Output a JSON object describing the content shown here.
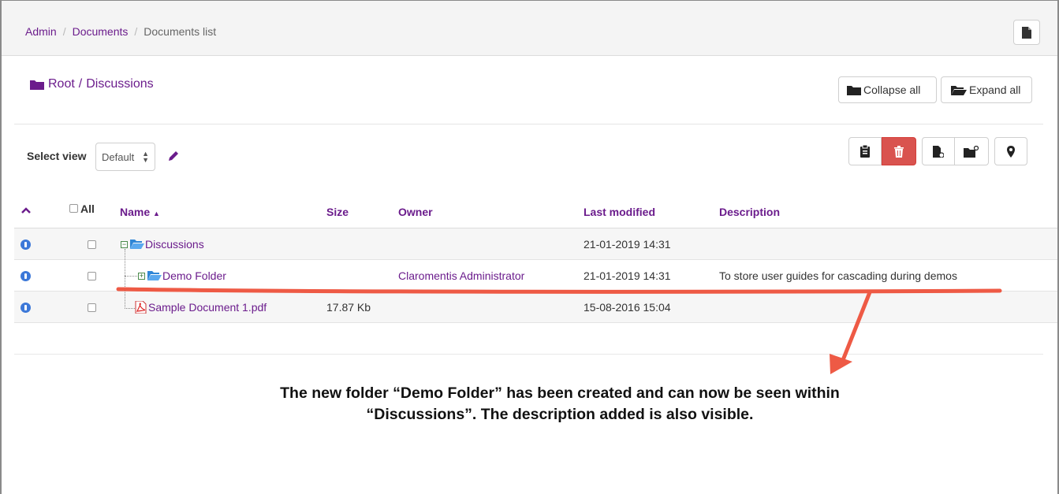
{
  "breadcrumb": {
    "items": [
      "Admin",
      "Documents"
    ],
    "current": "Documents list"
  },
  "path": {
    "root": "Root",
    "separator": "/",
    "folder": "Discussions"
  },
  "buttons": {
    "collapse_all": "Collapse all",
    "expand_all": "Expand all"
  },
  "select_view": {
    "label": "Select view",
    "value": "Default"
  },
  "table": {
    "headers": {
      "all": "All",
      "name": "Name",
      "size": "Size",
      "owner": "Owner",
      "last_modified": "Last modified",
      "description": "Description"
    },
    "rows": [
      {
        "name": "Discussions",
        "size": "",
        "owner": "",
        "last_modified": "21-01-2019 14:31",
        "description": ""
      },
      {
        "name": "Demo Folder",
        "size": "",
        "owner": "Claromentis Administrator",
        "last_modified": "21-01-2019 14:31",
        "description": "To store user guides for cascading during demos"
      },
      {
        "name": "Sample Document 1.pdf",
        "size": "17.87 Kb",
        "owner": "",
        "last_modified": "15-08-2016 15:04",
        "description": ""
      }
    ]
  },
  "annotation": "The new folder “Demo Folder” has been created and can now be seen within “Discussions”. The description added is also visible.",
  "colors": {
    "accent": "#6b1c8c",
    "delete": "#d9534f",
    "arrow": "#ee5a45",
    "info": "#3c78d8"
  }
}
